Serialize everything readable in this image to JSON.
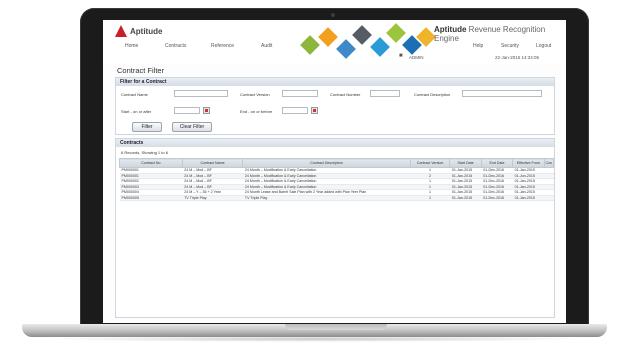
{
  "app": {
    "logo_text": "Aptitude",
    "product_brand": "Aptitude",
    "product_name": "Revenue Recognition Engine"
  },
  "nav": {
    "items": [
      "Home",
      "Contracts",
      "Reference",
      "Audit"
    ],
    "right_items": [
      "Help",
      "Security",
      "Logout"
    ]
  },
  "user": {
    "name": "ADMIN",
    "datetime": "22-Jan-2015 14:34:05"
  },
  "page": {
    "title": "Contract Filter"
  },
  "filter": {
    "panel_title": "Filter for a Contract",
    "labels": {
      "contract_name": "Contract Name",
      "contract_version": "Contract Version",
      "contract_number": "Contract Number",
      "contract_description": "Contract Description",
      "start_on_or_after": "Start - on or after",
      "end_on_or_before": "End - on or before"
    },
    "filter_button": "Filter",
    "clear_button": "Clear Filter"
  },
  "contracts": {
    "panel_title": "Contracts",
    "showing": "6 Records, Showing 1 to 6",
    "columns": [
      "Contract No",
      "Contract Name",
      "Contract Description",
      "Contract Version",
      "Start Date",
      "End Date",
      "Effective From",
      "Con"
    ],
    "rows": [
      [
        "PM000001",
        "24 M – Mod – BF",
        "24 Month – Modification & Early Cancellation",
        "1",
        "01-Jan-2015",
        "01-Dec-2016",
        "01-Jan-2015",
        ""
      ],
      [
        "PM000001",
        "24 M – Mod – BF",
        "24 Month – Modification & Early Cancellation",
        "2",
        "01-Jan-2015",
        "01-Dec-2016",
        "01-Jun-2015",
        ""
      ],
      [
        "PM000002",
        "24 M – Mod – BF",
        "24 Month – Modification & Early Cancellation",
        "1",
        "01-Jan-2015",
        "01-Dec-2016",
        "01-Jan-2015",
        ""
      ],
      [
        "PM000003",
        "24 M – Mod – BF",
        "24 Month – Modification & Early Cancellation",
        "1",
        "01-Jan-2015",
        "01-Dec-2016",
        "01-Jan-2015",
        ""
      ],
      [
        "PM000004",
        "24 M – Y – 36 + 2 Year",
        "24 Month Lease and Barrel Sale Plan with 2 Year added with Plan Yeer Plan",
        "1",
        "01-Jan-2015",
        "01-Dec-2016",
        "01-Jan-2015",
        ""
      ],
      [
        "PM000005",
        "TV Triple Play",
        "TV Triple Play",
        "1",
        "01-Jan-2015",
        "01-Dec-2016",
        "01-Jan-2015",
        ""
      ]
    ]
  },
  "colors": {
    "laptop_bezel": "#1b1b1c",
    "brand_red": "#c8202b",
    "header_row": "#d5dde6"
  }
}
